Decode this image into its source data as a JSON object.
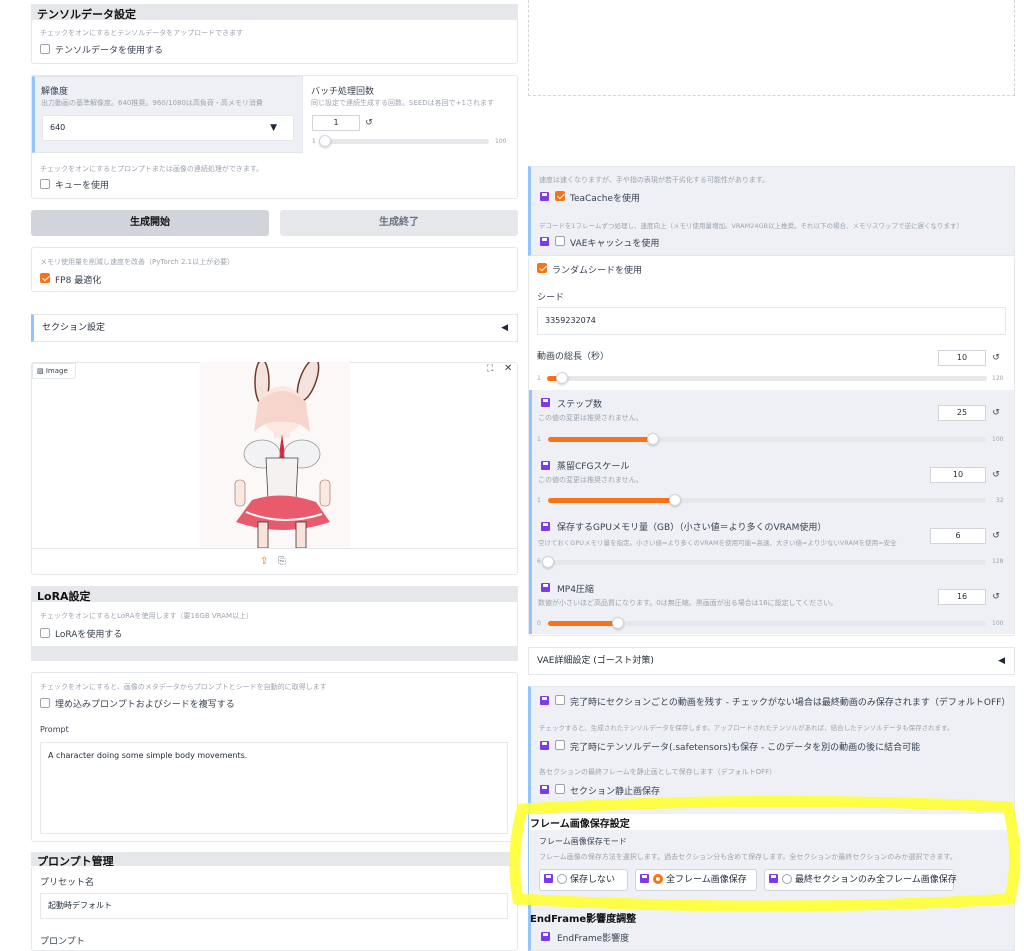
{
  "tensor": {
    "header": "テンソルデータ設定",
    "desc": "チェックをオンにするとテンソルデータをアップロードできます",
    "checkbox": "テンソルデータを使用する"
  },
  "resolution": {
    "label": "解像度",
    "desc": "出力動画の基準解像度。640推奨。960/1080は高負荷・高メモリ消費",
    "value": "640"
  },
  "batch": {
    "label": "バッチ処理回数",
    "desc": "同じ設定で連続生成する回数。SEEDは各回で+1されます",
    "value": "1",
    "min": "1",
    "max": "100"
  },
  "queue": {
    "desc": "チェックをオンにするとプロンプトまたは画像の連続処理ができます。",
    "checkbox": "キューを使用"
  },
  "buttons": {
    "start": "生成開始",
    "end": "生成終了"
  },
  "fp8": {
    "desc": "メモリ使用量を削減し速度を改善（PyTorch 2.1以上が必要）",
    "checkbox": "FP8 最適化"
  },
  "section": {
    "label": "セクション設定"
  },
  "image": {
    "label": "Image"
  },
  "lora": {
    "header": "LoRA設定",
    "desc": "チェックをオンにするとLoRAを使用します（要16GB VRAM以上）",
    "checkbox": "LoRAを使用する"
  },
  "metadata": {
    "desc": "チェックをオンにすると、画像のメタデータからプロンプトとシードを自動的に取得します",
    "checkbox": "埋め込みプロンプトおよびシードを複写する"
  },
  "prompt": {
    "label": "Prompt",
    "value": "A character doing some simple body movements."
  },
  "prompt_mgmt": {
    "header": "プロンプト管理",
    "preset_label": "プリセット名",
    "preset_value": "起動時デフォルト",
    "prompt_label": "プロンプト"
  },
  "teacache": {
    "desc": "速度は速くなりますが、手や指の表現が若干劣化する可能性があります。",
    "checkbox": "TeaCacheを使用"
  },
  "vae_cache": {
    "desc": "デコードを1フレームずつ処理し、速度向上（メモリ使用量増加。VRAM24GB以上推奨。それ以下の場合、メモリスワップで逆に遅くなります）",
    "checkbox": "VAEキャッシュを使用"
  },
  "random_seed": {
    "checkbox": "ランダムシードを使用"
  },
  "seed": {
    "label": "シード",
    "value": "3359232074"
  },
  "length": {
    "label": "動画の総長（秒）",
    "value": "10",
    "min": "1",
    "max": "120",
    "fraction": 0.035
  },
  "steps": {
    "label": "ステップ数",
    "desc": "この値の変更は推奨されません。",
    "value": "25",
    "min": "1",
    "max": "100",
    "fraction": 0.24
  },
  "cfg": {
    "label": "蒸留CFGスケール",
    "desc": "この値の変更は推奨されません。",
    "value": "10",
    "min": "1",
    "max": "32",
    "fraction": 0.29
  },
  "gpu": {
    "label": "保存するGPUメモリ量（GB）（小さい値＝より多くのVRAM使用）",
    "desc": "空けておくGPUメモリ量を指定。小さい値=より多くのVRAMを使用可能=高速、大きい値=より少ないVRAMを使用=安全",
    "value": "6",
    "min": "6",
    "max": "128",
    "fraction": 0.0
  },
  "mp4": {
    "label": "MP4圧縮",
    "desc": "数値が小さいほど高品質になります。0は無圧縮。黒画面が出る場合は16に設定してください。",
    "value": "16",
    "min": "0",
    "max": "100",
    "fraction": 0.16
  },
  "vae_detail": {
    "label": "VAE詳細設定 (ゴースト対策)"
  },
  "keep_section": {
    "checkbox": "完了時にセクションごとの動画を残す - チェックがない場合は最終動画のみ保存されます（デフォルトOFF）"
  },
  "save_tensor": {
    "desc": "チェックすると、生成されたテンソルデータを保存します。アップロードされたテンソルがあれば、結合したテンソルデータも保存されます。",
    "checkbox": "完了時にテンソルデータ(.safetensors)も保存 - このデータを別の動画の後に結合可能"
  },
  "still": {
    "desc": "各セクションの最終フレームを静止画として保存します（デフォルトOFF）",
    "checkbox": "セクション静止画保存"
  },
  "frame_save": {
    "header": "フレーム画像保存設定",
    "mode_label": "フレーム画像保存モード",
    "desc": "フレーム画像の保存方法を選択します。過去セクション分も含めて保存します。全セクションか最終セクションのみか選択できます。",
    "options": [
      "保存しない",
      "全フレーム画像保存",
      "最終セクションのみ全フレーム画像保存"
    ],
    "selected": "全フレーム画像保存"
  },
  "endframe": {
    "header": "EndFrame影響度調整",
    "label": "EndFrame影響度"
  },
  "colors": {
    "accent": "#f97316",
    "highlight": "#ffff33",
    "disk": "#7c3aed"
  }
}
